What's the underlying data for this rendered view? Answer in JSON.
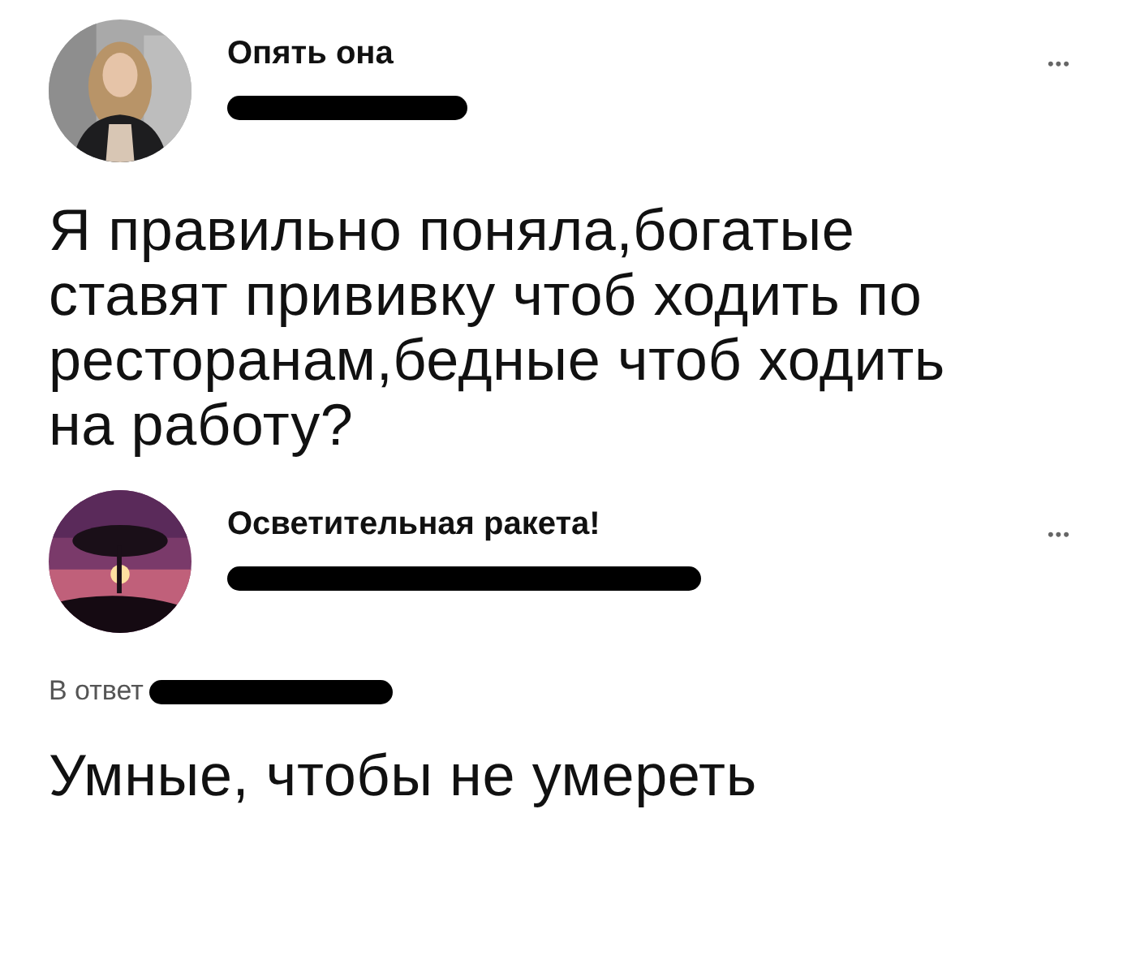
{
  "tweets": [
    {
      "name": "Опять она",
      "handle_redacted": true,
      "text": "Я правильно поняла,богатые ставят прививку чтоб ходить по ресторанам,бедные чтоб ходить на работу?",
      "more": "•••"
    },
    {
      "name": "Осветительная ракета!",
      "handle_redacted": true,
      "reply_label": "В ответ",
      "text": "Умные, чтобы не умереть",
      "more": "•••"
    }
  ]
}
